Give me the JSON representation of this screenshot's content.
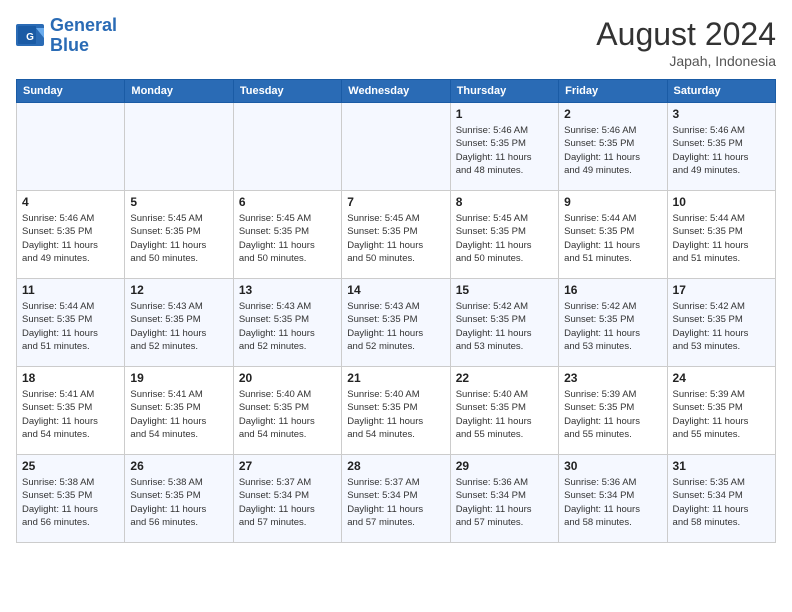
{
  "header": {
    "logo_line1": "General",
    "logo_line2": "Blue",
    "month_year": "August 2024",
    "location": "Japah, Indonesia"
  },
  "weekdays": [
    "Sunday",
    "Monday",
    "Tuesday",
    "Wednesday",
    "Thursday",
    "Friday",
    "Saturday"
  ],
  "weeks": [
    [
      {
        "day": "",
        "info": ""
      },
      {
        "day": "",
        "info": ""
      },
      {
        "day": "",
        "info": ""
      },
      {
        "day": "",
        "info": ""
      },
      {
        "day": "1",
        "info": "Sunrise: 5:46 AM\nSunset: 5:35 PM\nDaylight: 11 hours\nand 48 minutes."
      },
      {
        "day": "2",
        "info": "Sunrise: 5:46 AM\nSunset: 5:35 PM\nDaylight: 11 hours\nand 49 minutes."
      },
      {
        "day": "3",
        "info": "Sunrise: 5:46 AM\nSunset: 5:35 PM\nDaylight: 11 hours\nand 49 minutes."
      }
    ],
    [
      {
        "day": "4",
        "info": "Sunrise: 5:46 AM\nSunset: 5:35 PM\nDaylight: 11 hours\nand 49 minutes."
      },
      {
        "day": "5",
        "info": "Sunrise: 5:45 AM\nSunset: 5:35 PM\nDaylight: 11 hours\nand 50 minutes."
      },
      {
        "day": "6",
        "info": "Sunrise: 5:45 AM\nSunset: 5:35 PM\nDaylight: 11 hours\nand 50 minutes."
      },
      {
        "day": "7",
        "info": "Sunrise: 5:45 AM\nSunset: 5:35 PM\nDaylight: 11 hours\nand 50 minutes."
      },
      {
        "day": "8",
        "info": "Sunrise: 5:45 AM\nSunset: 5:35 PM\nDaylight: 11 hours\nand 50 minutes."
      },
      {
        "day": "9",
        "info": "Sunrise: 5:44 AM\nSunset: 5:35 PM\nDaylight: 11 hours\nand 51 minutes."
      },
      {
        "day": "10",
        "info": "Sunrise: 5:44 AM\nSunset: 5:35 PM\nDaylight: 11 hours\nand 51 minutes."
      }
    ],
    [
      {
        "day": "11",
        "info": "Sunrise: 5:44 AM\nSunset: 5:35 PM\nDaylight: 11 hours\nand 51 minutes."
      },
      {
        "day": "12",
        "info": "Sunrise: 5:43 AM\nSunset: 5:35 PM\nDaylight: 11 hours\nand 52 minutes."
      },
      {
        "day": "13",
        "info": "Sunrise: 5:43 AM\nSunset: 5:35 PM\nDaylight: 11 hours\nand 52 minutes."
      },
      {
        "day": "14",
        "info": "Sunrise: 5:43 AM\nSunset: 5:35 PM\nDaylight: 11 hours\nand 52 minutes."
      },
      {
        "day": "15",
        "info": "Sunrise: 5:42 AM\nSunset: 5:35 PM\nDaylight: 11 hours\nand 53 minutes."
      },
      {
        "day": "16",
        "info": "Sunrise: 5:42 AM\nSunset: 5:35 PM\nDaylight: 11 hours\nand 53 minutes."
      },
      {
        "day": "17",
        "info": "Sunrise: 5:42 AM\nSunset: 5:35 PM\nDaylight: 11 hours\nand 53 minutes."
      }
    ],
    [
      {
        "day": "18",
        "info": "Sunrise: 5:41 AM\nSunset: 5:35 PM\nDaylight: 11 hours\nand 54 minutes."
      },
      {
        "day": "19",
        "info": "Sunrise: 5:41 AM\nSunset: 5:35 PM\nDaylight: 11 hours\nand 54 minutes."
      },
      {
        "day": "20",
        "info": "Sunrise: 5:40 AM\nSunset: 5:35 PM\nDaylight: 11 hours\nand 54 minutes."
      },
      {
        "day": "21",
        "info": "Sunrise: 5:40 AM\nSunset: 5:35 PM\nDaylight: 11 hours\nand 54 minutes."
      },
      {
        "day": "22",
        "info": "Sunrise: 5:40 AM\nSunset: 5:35 PM\nDaylight: 11 hours\nand 55 minutes."
      },
      {
        "day": "23",
        "info": "Sunrise: 5:39 AM\nSunset: 5:35 PM\nDaylight: 11 hours\nand 55 minutes."
      },
      {
        "day": "24",
        "info": "Sunrise: 5:39 AM\nSunset: 5:35 PM\nDaylight: 11 hours\nand 55 minutes."
      }
    ],
    [
      {
        "day": "25",
        "info": "Sunrise: 5:38 AM\nSunset: 5:35 PM\nDaylight: 11 hours\nand 56 minutes."
      },
      {
        "day": "26",
        "info": "Sunrise: 5:38 AM\nSunset: 5:35 PM\nDaylight: 11 hours\nand 56 minutes."
      },
      {
        "day": "27",
        "info": "Sunrise: 5:37 AM\nSunset: 5:34 PM\nDaylight: 11 hours\nand 57 minutes."
      },
      {
        "day": "28",
        "info": "Sunrise: 5:37 AM\nSunset: 5:34 PM\nDaylight: 11 hours\nand 57 minutes."
      },
      {
        "day": "29",
        "info": "Sunrise: 5:36 AM\nSunset: 5:34 PM\nDaylight: 11 hours\nand 57 minutes."
      },
      {
        "day": "30",
        "info": "Sunrise: 5:36 AM\nSunset: 5:34 PM\nDaylight: 11 hours\nand 58 minutes."
      },
      {
        "day": "31",
        "info": "Sunrise: 5:35 AM\nSunset: 5:34 PM\nDaylight: 11 hours\nand 58 minutes."
      }
    ]
  ]
}
